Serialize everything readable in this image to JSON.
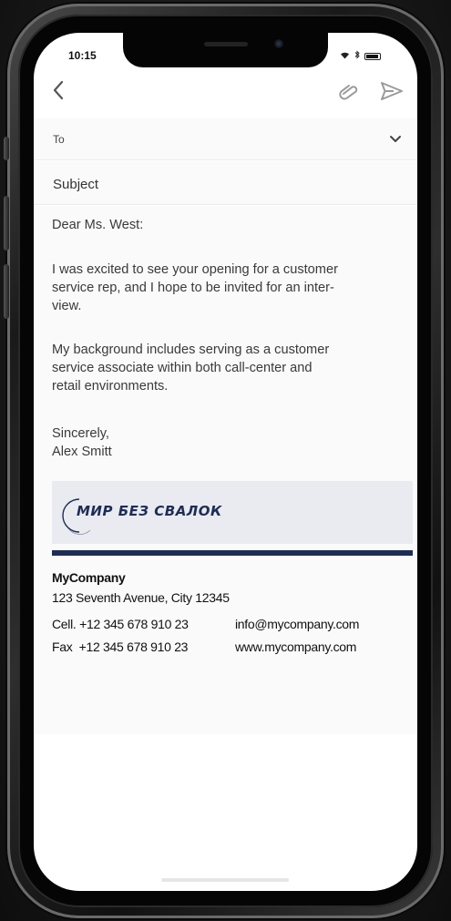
{
  "status_bar": {
    "time": "10:15",
    "wifi_icon": "wifi-icon",
    "bluetooth_icon": "bluetooth-icon",
    "battery_level": 0.8
  },
  "toolbar": {
    "back_icon": "chevron-left-icon",
    "attach_icon": "paperclip-icon",
    "send_icon": "send-icon",
    "icon_color": "#9a9a9a"
  },
  "compose": {
    "to_label": "To",
    "to_value": "",
    "subject_placeholder": "Subject",
    "chevron_icon": "chevron-down-icon"
  },
  "body": {
    "greeting": "Dear Ms. West:",
    "paragraph_1_line_1": "I was excited to see your opening for a customer",
    "paragraph_1_line_2": "service rep, and I hope to be invited for an inter-",
    "paragraph_1_line_3": "view.",
    "paragraph_2_line_1": "My background includes serving as a customer",
    "paragraph_2_line_2": "service associate within both call-center and",
    "paragraph_2_line_3": "retail environments.",
    "closing": "Sincerely,",
    "sender": "Alex Smitt"
  },
  "signature": {
    "logo_text": "МИР БЕЗ СВАЛОК",
    "logo_color": "#1e2d55",
    "bar_color": "#1f2d56",
    "company": "MyCompany",
    "address": "123 Seventh Avenue, City 12345",
    "cell": "Cell. +12 345 678 910 23",
    "email": "info@mycompany.com",
    "fax": "Fax  +12 345 678 910 23",
    "website": "www.mycompany.com"
  }
}
